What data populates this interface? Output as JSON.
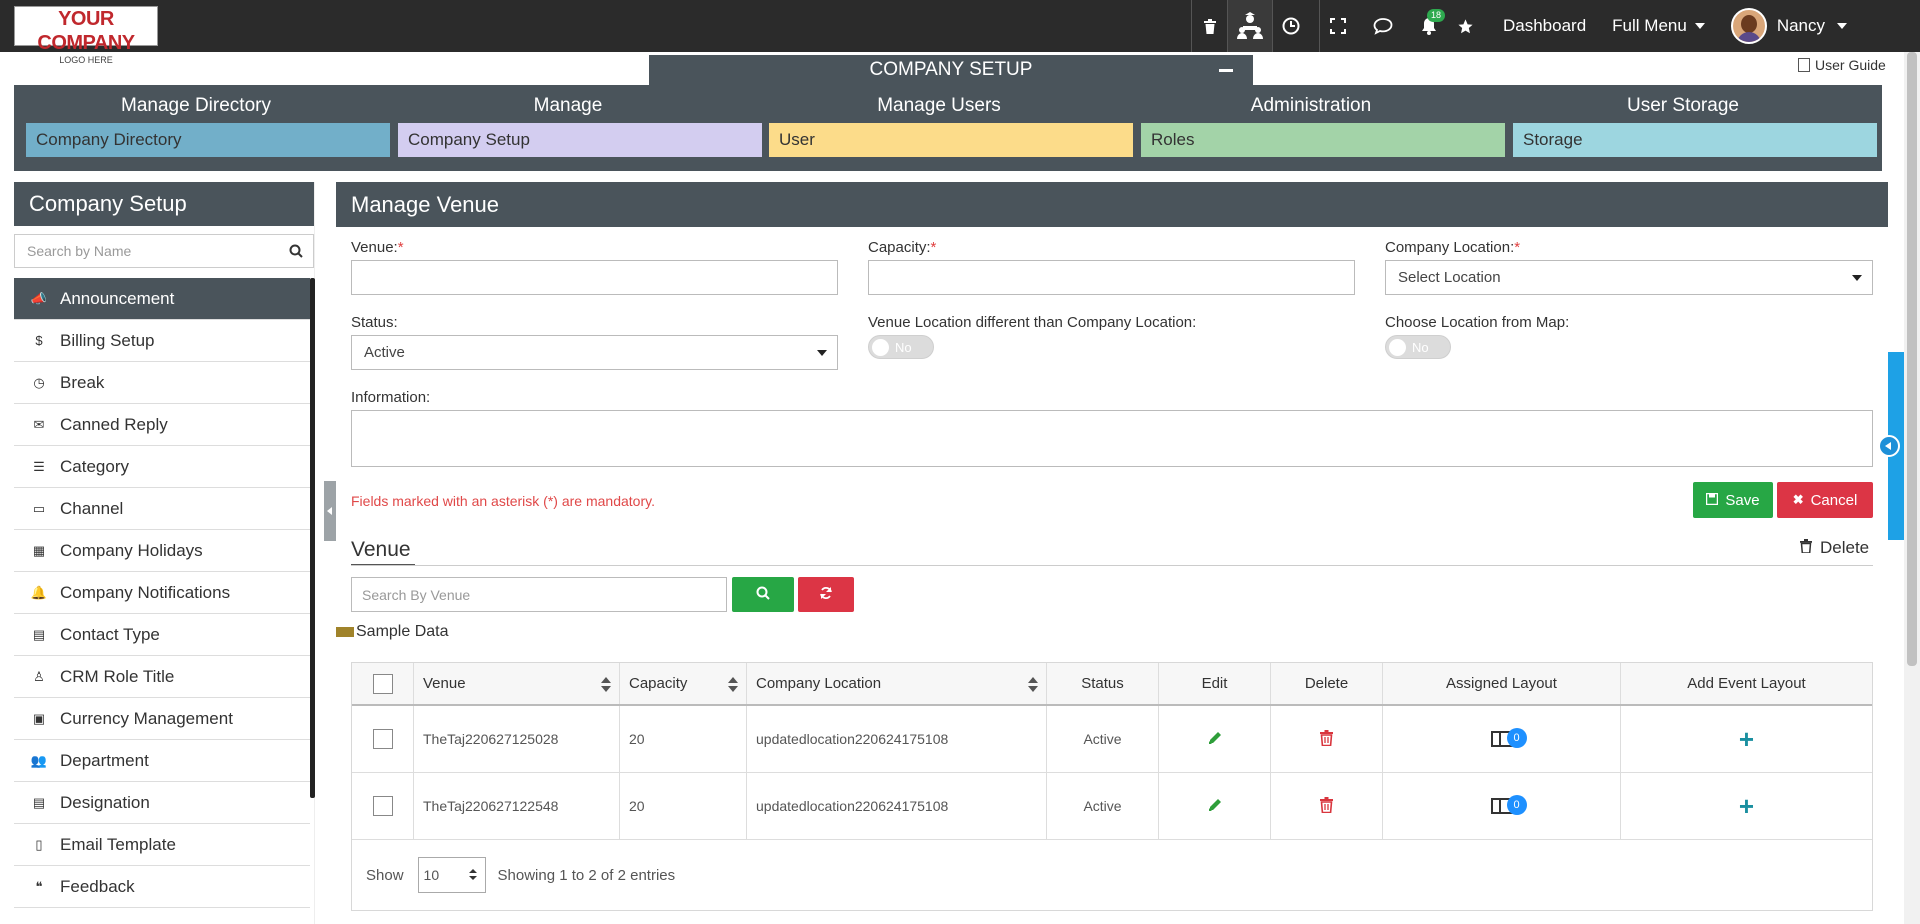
{
  "logo": {
    "line1": "YOUR COMPANY",
    "line2": "LOGO HERE"
  },
  "topbar": {
    "notification_count": "18",
    "dashboard_label": "Dashboard",
    "full_menu_label": "Full Menu",
    "user_name": "Nancy"
  },
  "setup_tab": {
    "title": "COMPANY SETUP"
  },
  "user_guide_label": "User Guide",
  "directory_nav": [
    {
      "heading": "Manage Directory",
      "item": "Company Directory",
      "color": "#72afc9"
    },
    {
      "heading": "Manage",
      "item": "Company Setup",
      "color": "#d3cdf0"
    },
    {
      "heading": "Manage Users",
      "item": "User",
      "color": "#fcdc8a"
    },
    {
      "heading": "Administration",
      "item": "Roles",
      "color": "#a3d3a8"
    },
    {
      "heading": "User Storage",
      "item": "Storage",
      "color": "#9dd6e0"
    }
  ],
  "sidebar": {
    "title": "Company Setup",
    "search_placeholder": "Search by Name",
    "items": [
      {
        "label": "Announcement",
        "icon": "megaphone-icon",
        "glyph": "📣"
      },
      {
        "label": "Billing Setup",
        "icon": "dollar-icon",
        "glyph": "$"
      },
      {
        "label": "Break",
        "icon": "clock-icon",
        "glyph": "◷"
      },
      {
        "label": "Canned Reply",
        "icon": "envelope-icon",
        "glyph": "✉"
      },
      {
        "label": "Category",
        "icon": "list-icon",
        "glyph": "☰"
      },
      {
        "label": "Channel",
        "icon": "monitor-icon",
        "glyph": "▭"
      },
      {
        "label": "Company Holidays",
        "icon": "calendar-icon",
        "glyph": "▦"
      },
      {
        "label": "Company Notifications",
        "icon": "bell-icon",
        "glyph": "🔔"
      },
      {
        "label": "Contact Type",
        "icon": "card-icon",
        "glyph": "▤"
      },
      {
        "label": "CRM Role Title",
        "icon": "user-icon",
        "glyph": "♙"
      },
      {
        "label": "Currency Management",
        "icon": "money-icon",
        "glyph": "▣"
      },
      {
        "label": "Department",
        "icon": "users-icon",
        "glyph": "👥"
      },
      {
        "label": "Designation",
        "icon": "id-card-icon",
        "glyph": "▤"
      },
      {
        "label": "Email Template",
        "icon": "file-icon",
        "glyph": "▯"
      },
      {
        "label": "Feedback",
        "icon": "quote-icon",
        "glyph": "❝"
      }
    ]
  },
  "main": {
    "title": "Manage Venue",
    "form": {
      "venue_label": "Venue:",
      "capacity_label": "Capacity:",
      "company_location_label": "Company Location:",
      "company_location_value": "Select Location",
      "status_label": "Status:",
      "status_value": "Active",
      "venue_location_diff_label": "Venue Location different than Company Location:",
      "venue_location_diff_value": "No",
      "choose_map_label": "Choose Location from Map:",
      "choose_map_value": "No",
      "information_label": "Information:",
      "required_mark": "*",
      "mandatory_note": "Fields marked with an asterisk (*) are mandatory.",
      "save_label": "Save",
      "cancel_label": "Cancel"
    },
    "venue_section": {
      "heading": "Venue",
      "delete_label": "Delete",
      "search_placeholder": "Search By Venue",
      "legend_label": "Sample Data"
    },
    "table": {
      "columns": [
        "Venue",
        "Capacity",
        "Company Location",
        "Status",
        "Edit",
        "Delete",
        "Assigned Layout",
        "Add Event Layout"
      ],
      "rows": [
        {
          "venue": "TheTaj220627125028",
          "capacity": "20",
          "location": "updatedlocation220624175108",
          "status": "Active",
          "assigned_layout_count": "0"
        },
        {
          "venue": "TheTaj220627122548",
          "capacity": "20",
          "location": "updatedlocation220624175108",
          "status": "Active",
          "assigned_layout_count": "0"
        }
      ],
      "show_label": "Show",
      "page_size": "10",
      "entries_info": "Showing 1 to 2 of 2 entries"
    }
  }
}
